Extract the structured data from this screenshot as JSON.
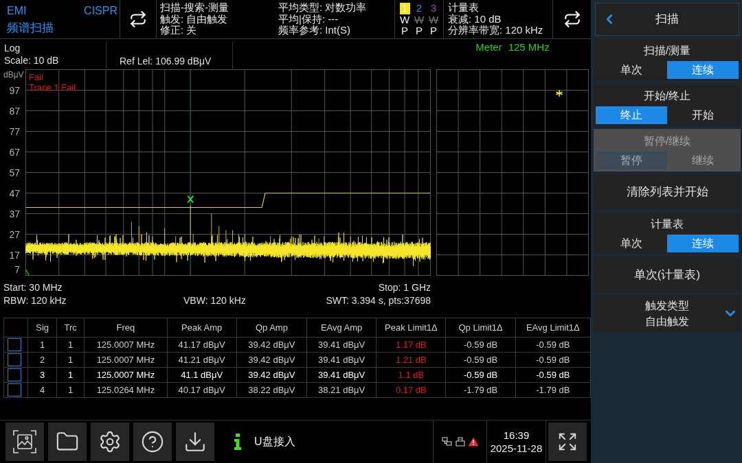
{
  "header": {
    "mode": "EMI",
    "standard": "CISPR",
    "function": "频谱扫描",
    "sweep_info": [
      "扫描-搜索-测量",
      "触发: 自由触发",
      "修正: 关"
    ],
    "average_info": [
      "平均类型: 对数功率",
      "平均|保持: ---",
      "频率参考: Int(S)"
    ],
    "traces": [
      {
        "number": "1",
        "color": "#f5e52a",
        "selected": true,
        "mode": "W",
        "mode_active": true,
        "detector": "P"
      },
      {
        "number": "2",
        "color": "#2b8fe8",
        "selected": false,
        "mode": "W",
        "mode_active": false,
        "detector": "P"
      },
      {
        "number": "3",
        "color": "#a63cc0",
        "selected": false,
        "mode": "W",
        "mode_active": false,
        "detector": "P"
      }
    ],
    "meter_info": [
      "计量表",
      "衰减: 10 dB",
      "分辨率带宽: 120 kHz"
    ]
  },
  "display": {
    "scale_type": "Log",
    "scale": "Scale: 10 dB",
    "ref_level": "Ref Lel: 106.99 dBμV"
  },
  "spectrum": {
    "messages": [
      "Fail",
      "Trace 1 Fail"
    ],
    "chart_data": {
      "type": "line",
      "ylabel": "dBμV",
      "grid": true,
      "categories": [
        null,
        null,
        null,
        null,
        null,
        null,
        null,
        null,
        null,
        null,
        null,
        null,
        null,
        null,
        null,
        null,
        null,
        null,
        null,
        null,
        null,
        null,
        null,
        null,
        null,
        null,
        null,
        null,
        null,
        null,
        null,
        null,
        null,
        null,
        null,
        null,
        null,
        null,
        null,
        null,
        null,
        null,
        null,
        null,
        null,
        null,
        null,
        null,
        null,
        null,
        null,
        null,
        null,
        null,
        null,
        null,
        null,
        null,
        null,
        null,
        null,
        null,
        null,
        null,
        null,
        null,
        null,
        null,
        null,
        null,
        null,
        null,
        null,
        null,
        null,
        null,
        null,
        null,
        null,
        null,
        null,
        null,
        null,
        null,
        null,
        null,
        null,
        null,
        null,
        null,
        null,
        null,
        null,
        null,
        null,
        null,
        null,
        null,
        null,
        null,
        null,
        null,
        null,
        null,
        null,
        null,
        null,
        null,
        null,
        null,
        null,
        null,
        null,
        null,
        null,
        null,
        null,
        null,
        null,
        null,
        null
      ],
      "ylim": [
        7,
        107
      ],
      "yticks": [
        {
          "value": 97,
          "label": "97"
        },
        {
          "value": 87,
          "label": "87"
        },
        {
          "value": 77,
          "label": "77"
        },
        {
          "value": 67,
          "label": "67"
        },
        {
          "value": 57,
          "label": "57"
        },
        {
          "value": 47,
          "label": "47"
        },
        {
          "value": 37,
          "label": "37"
        },
        {
          "value": 27,
          "label": "27"
        },
        {
          "value": 17,
          "label": "17"
        },
        {
          "value": 7,
          "label": "7"
        }
      ],
      "series": [
        {
          "color": "#d9c93c",
          "values": [
            40,
            40,
            40,
            40,
            40,
            40,
            40,
            40,
            40,
            40,
            40,
            40,
            40,
            40,
            40,
            40,
            40,
            40,
            40,
            40,
            40,
            40,
            40,
            40,
            40,
            40,
            40,
            40,
            40,
            40,
            40,
            40,
            40,
            40,
            40,
            40,
            40,
            40,
            40,
            40,
            40,
            40,
            40,
            40,
            40,
            40,
            40,
            40,
            40,
            40,
            40,
            40,
            40,
            40,
            40,
            40,
            40,
            40,
            40,
            40,
            40,
            40,
            40,
            40,
            40,
            40,
            40,
            40,
            40,
            40,
            40,
            47,
            47,
            47,
            47,
            47,
            47,
            47,
            47,
            47,
            47,
            47,
            47,
            47,
            47,
            47,
            47,
            47,
            47,
            47,
            47,
            47,
            47,
            47,
            47,
            47,
            47,
            47,
            47,
            47,
            47,
            47,
            47,
            47,
            47,
            47,
            47,
            47,
            47,
            47,
            47,
            47,
            47,
            47,
            47,
            47,
            47,
            47,
            47,
            47,
            47
          ]
        }
      ]
    }
  },
  "meter": {
    "title": "Meter",
    "frequency": "125 MHz"
  },
  "sweep": {
    "start": "Start: 30 MHz",
    "stop": "Stop: 1 GHz",
    "rbw": "RBW: 120 kHz",
    "vbw": "VBW: 120 kHz",
    "swt": "SWT: 3.394 s, pts:37698"
  },
  "signal_table": {
    "columns": [
      "Sig",
      "Trc",
      "Freq",
      "Peak Amp",
      "Qp Amp",
      "EAvg Amp",
      "Peak Limit1Δ",
      "Qp Limit1Δ",
      "EAvg Limit1Δ"
    ],
    "rows": [
      {
        "checked": false,
        "selected": false,
        "peak_limit_exceeded": true,
        "cells": [
          "1",
          "1",
          "125.0007 MHz",
          "41.17 dBμV",
          "39.42 dBμV",
          "39.41 dBμV",
          "1.17 dB",
          "-0.59 dB",
          "-0.59 dB"
        ]
      },
      {
        "checked": false,
        "selected": false,
        "peak_limit_exceeded": true,
        "cells": [
          "2",
          "1",
          "125.0007 MHz",
          "41.21 dBμV",
          "39.42 dBμV",
          "39.41 dBμV",
          "1.21 dB",
          "-0.59 dB",
          "-0.59 dB"
        ]
      },
      {
        "checked": false,
        "selected": true,
        "peak_limit_exceeded": true,
        "cells": [
          "3",
          "1",
          "125.0007 MHz",
          "41.1 dBμV",
          "39.42 dBμV",
          "39.41 dBμV",
          "1.1 dB",
          "-0.59 dB",
          "-0.59 dB"
        ]
      },
      {
        "checked": false,
        "selected": false,
        "peak_limit_exceeded": true,
        "cells": [
          "4",
          "1",
          "125.0264 MHz",
          "40.17 dBμV",
          "38.22 dBμV",
          "38.21 dBμV",
          "0.17 dB",
          "-1.79 dB",
          "-1.79 dB"
        ]
      }
    ]
  },
  "status_bar": {
    "message": "U盘接入",
    "time": "16:39",
    "date": "2025-11-28"
  },
  "menu": {
    "title": "扫描",
    "items": [
      {
        "kind": "toggle",
        "label": "扫描/测量",
        "disabled": false,
        "options": [
          {
            "label": "单次",
            "selected": false
          },
          {
            "label": "连续",
            "selected": true
          }
        ]
      },
      {
        "kind": "toggle",
        "label": "开始/终止",
        "disabled": false,
        "options": [
          {
            "label": "终止",
            "selected": true
          },
          {
            "label": "开始",
            "selected": false
          }
        ]
      },
      {
        "kind": "toggle",
        "label": "暂停/继续",
        "disabled": true,
        "options": [
          {
            "label": "暂停",
            "selected": true
          },
          {
            "label": "继续",
            "selected": false
          }
        ]
      },
      {
        "kind": "button",
        "label": "清除列表并开始",
        "disabled": false
      },
      {
        "kind": "toggle",
        "label": "计量表",
        "disabled": false,
        "options": [
          {
            "label": "单次",
            "selected": false
          },
          {
            "label": "连续",
            "selected": true
          }
        ]
      },
      {
        "kind": "button",
        "label": "单次(计量表)",
        "disabled": false
      },
      {
        "kind": "dropdown",
        "label": "触发类型",
        "value": "自由触发",
        "disabled": false
      }
    ]
  }
}
